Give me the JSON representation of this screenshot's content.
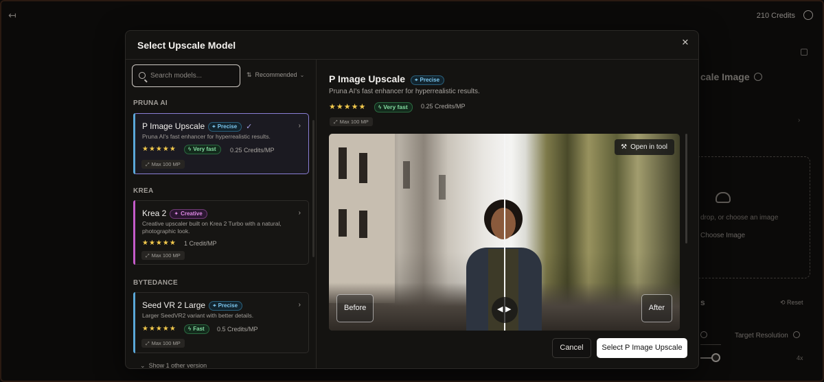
{
  "background": {
    "credits": "210 Credits",
    "title_fragment": "cale Image",
    "drop_text": "drop, or choose an image",
    "choose_image": "Choose Image",
    "section_fragment": "s",
    "reset": "Reset",
    "target_resolution": "Target Resolution",
    "scale_value": "4x"
  },
  "modal": {
    "title": "Select Upscale Model",
    "close_glyph": "✕",
    "search": {
      "placeholder": "Search models..."
    },
    "sort": {
      "label": "Recommended"
    },
    "groups": [
      {
        "name": "PRUNA AI",
        "model": {
          "name": "P Image Upscale",
          "badge": "Precise",
          "description": "Pruna AI's fast enhancer for hyperrealistic results.",
          "stars": "★★★★★",
          "speed": "Very fast",
          "credits": "0.25 Credits/MP",
          "max": "Max 100 MP",
          "selected": true
        }
      },
      {
        "name": "KREA",
        "model": {
          "name": "Krea 2",
          "badge": "Creative",
          "description": "Creative upscaler built on Krea 2 Turbo with a natural, photographic look.",
          "stars": "★★★★★",
          "credits": "1 Credit/MP",
          "max": "Max 100 MP"
        }
      },
      {
        "name": "BYTEDANCE",
        "model": {
          "name": "Seed VR 2 Large",
          "badge": "Precise",
          "description": "Larger SeedVR2 variant with better details.",
          "stars": "★★★★★",
          "speed": "Fast",
          "credits": "0.5 Credits/MP",
          "max": "Max 100 MP"
        }
      }
    ],
    "show_more": "Show 1 other version",
    "detail": {
      "title": "P Image Upscale",
      "badge": "Precise",
      "description": "Pruna AI's fast enhancer for hyperrealistic results.",
      "stars": "★★★★★",
      "speed": "Very fast",
      "credits": "0.25 Credits/MP",
      "max": "Max 100 MP",
      "open_in_tool": "Open in tool",
      "before_label": "Before",
      "after_label": "After"
    },
    "cancel": "Cancel",
    "select": "Select P Image Upscale"
  },
  "colors": {
    "accent": "#8b7fd6",
    "precise": "#7cc6ee",
    "creative": "#e08ae6",
    "fast": "#83dca0",
    "stars": "#f2c94c"
  }
}
